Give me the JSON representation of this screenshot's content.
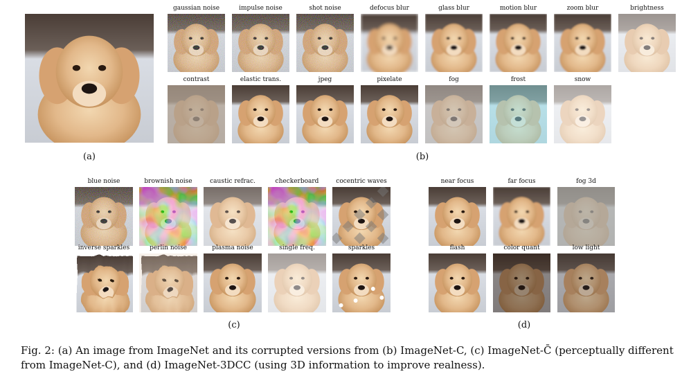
{
  "panel_a": {
    "subcaption": "(a)"
  },
  "panel_b": {
    "subcaption": "(b)",
    "labels": [
      "gaussian noise",
      "impulse noise",
      "shot noise",
      "defocus blur",
      "glass blur",
      "motion blur",
      "zoom blur",
      "brightness",
      "contrast",
      "elastic trans.",
      "jpeg",
      "pixelate",
      "fog",
      "frost",
      "snow"
    ]
  },
  "panel_c": {
    "subcaption": "(c)",
    "labels": [
      "blue noise",
      "brownish noise",
      "caustic refrac.",
      "checkerboard",
      "cocentric waves",
      "inverse sparkles",
      "perlin noise",
      "plasma noise",
      "single freq.",
      "sparkles"
    ]
  },
  "panel_d": {
    "subcaption": "(d)",
    "labels": [
      "near focus",
      "far focus",
      "fog 3d",
      "flash",
      "color quant",
      "low light"
    ]
  },
  "caption": {
    "text": "Fig. 2: (a) An image from ImageNet and its corrupted versions from (b) ImageNet-C, (c) ImageNet-C̄ (perceptually different from ImageNet-C), and (d) ImageNet-3DCC (using 3D information to improve realness)."
  }
}
